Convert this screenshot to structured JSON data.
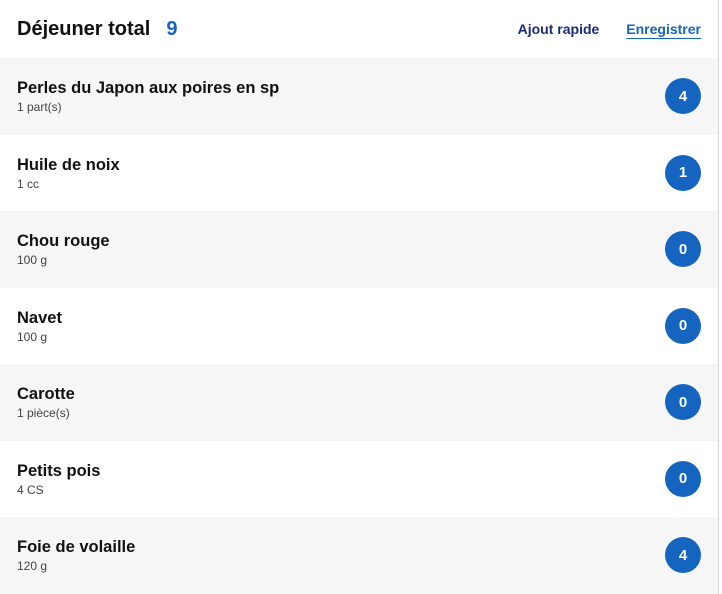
{
  "header": {
    "title": "Déjeuner total",
    "total": "9",
    "quick_add_label": "Ajout rapide",
    "save_label": "Enregistrer"
  },
  "items": [
    {
      "name": "Perles du Japon aux poires en sp",
      "quantity": "1 part(s)",
      "points": "4"
    },
    {
      "name": "Huile de noix",
      "quantity": "1 cc",
      "points": "1"
    },
    {
      "name": "Chou rouge",
      "quantity": "100 g",
      "points": "0"
    },
    {
      "name": "Navet",
      "quantity": "100 g",
      "points": "0"
    },
    {
      "name": "Carotte",
      "quantity": "1 pièce(s)",
      "points": "0"
    },
    {
      "name": "Petits pois",
      "quantity": "4 CS",
      "points": "0"
    },
    {
      "name": "Foie de volaille",
      "quantity": "120 g",
      "points": "4"
    }
  ],
  "colors": {
    "accent": "#1565c0",
    "quick_add": "#1a2a7c",
    "row_alt": "#f6f6f6"
  }
}
